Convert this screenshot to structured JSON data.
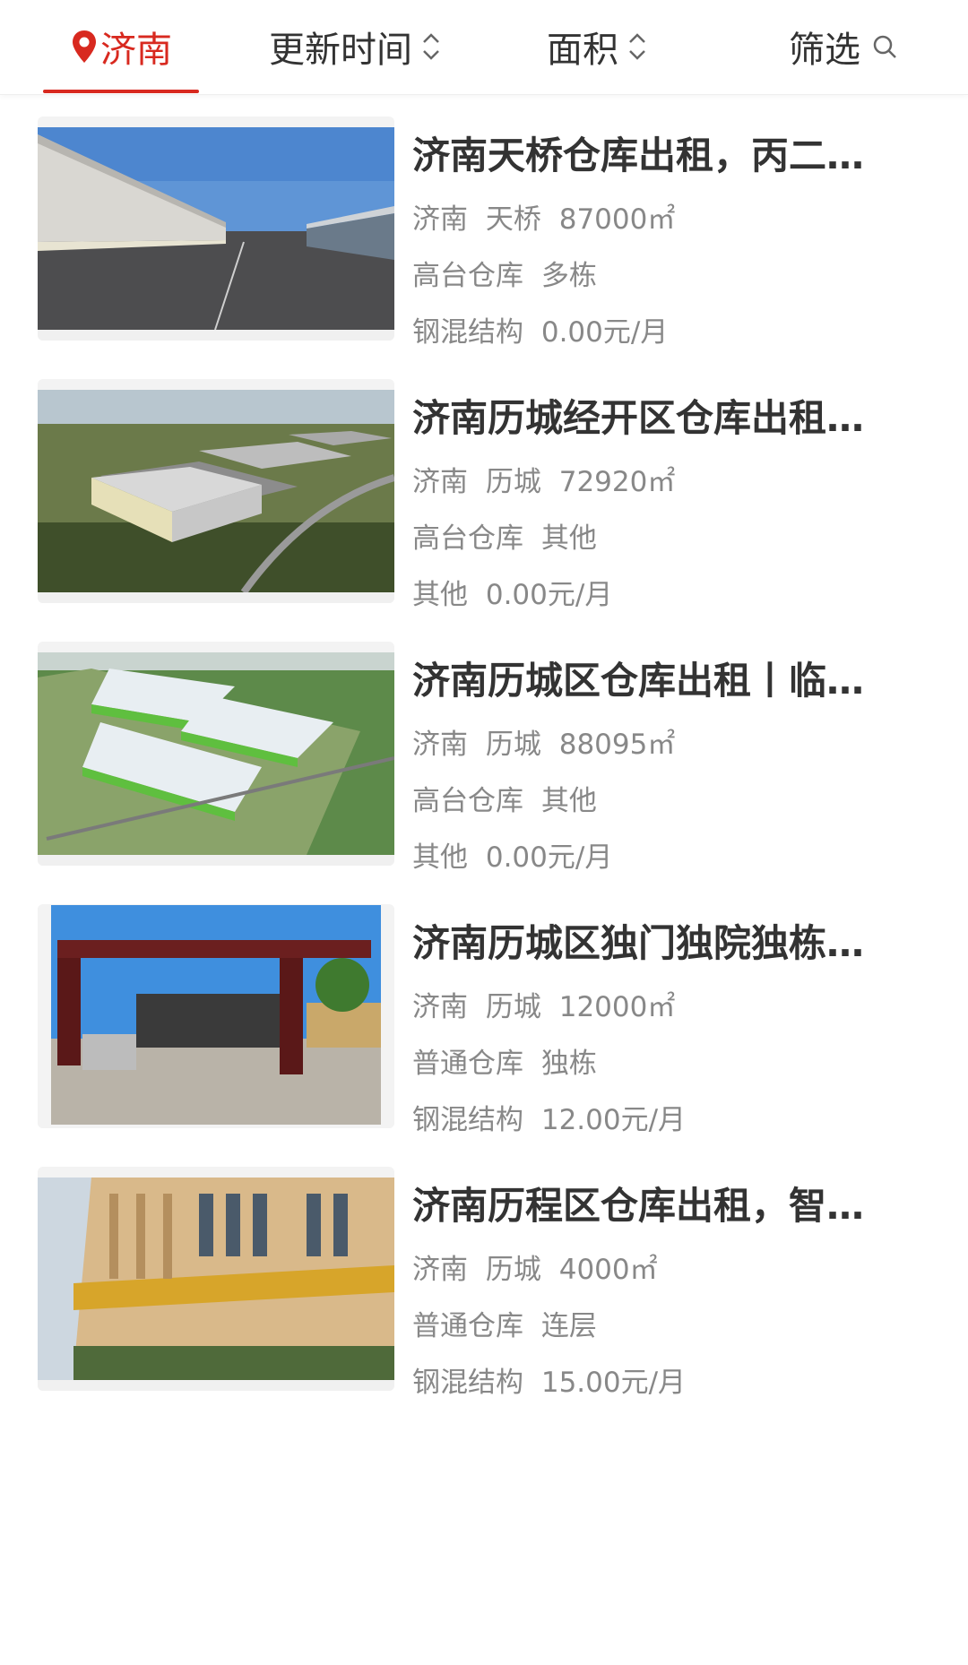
{
  "tabs": {
    "city": "济南",
    "update_time": "更新时间",
    "area": "面积",
    "filter": "筛选"
  },
  "colors": {
    "accent": "#d8291f",
    "text": "#333333",
    "muted": "#888888"
  },
  "listings": [
    {
      "title": "济南天桥仓库出租，丙二…",
      "city": "济南",
      "district": "天桥",
      "area": "87000㎡",
      "type": "高台仓库",
      "building": "多栋",
      "structure": "钢混结构",
      "price": "0.00元/月",
      "image": "warehouse-dock-photo"
    },
    {
      "title": "济南历城经开区仓库出租…",
      "city": "济南",
      "district": "历城",
      "area": "72920㎡",
      "type": "高台仓库",
      "building": "其他",
      "structure": "其他",
      "price": "0.00元/月",
      "image": "aerial-warehouse-photo"
    },
    {
      "title": "济南历城区仓库出租丨临…",
      "city": "济南",
      "district": "历城",
      "area": "88095㎡",
      "type": "高台仓库",
      "building": "其他",
      "structure": "其他",
      "price": "0.00元/月",
      "image": "warehouse-rendering"
    },
    {
      "title": "济南历城区独门独院独栋…",
      "city": "济南",
      "district": "历城",
      "area": "12000㎡",
      "type": "普通仓库",
      "building": "独栋",
      "structure": "钢混结构",
      "price": "12.00元/月",
      "image": "gate-photo"
    },
    {
      "title": "济南历程区仓库出租，智…",
      "city": "济南",
      "district": "历城",
      "area": "4000㎡",
      "type": "普通仓库",
      "building": "连层",
      "structure": "钢混结构",
      "price": "15.00元/月",
      "image": "building-facade-photo"
    }
  ]
}
